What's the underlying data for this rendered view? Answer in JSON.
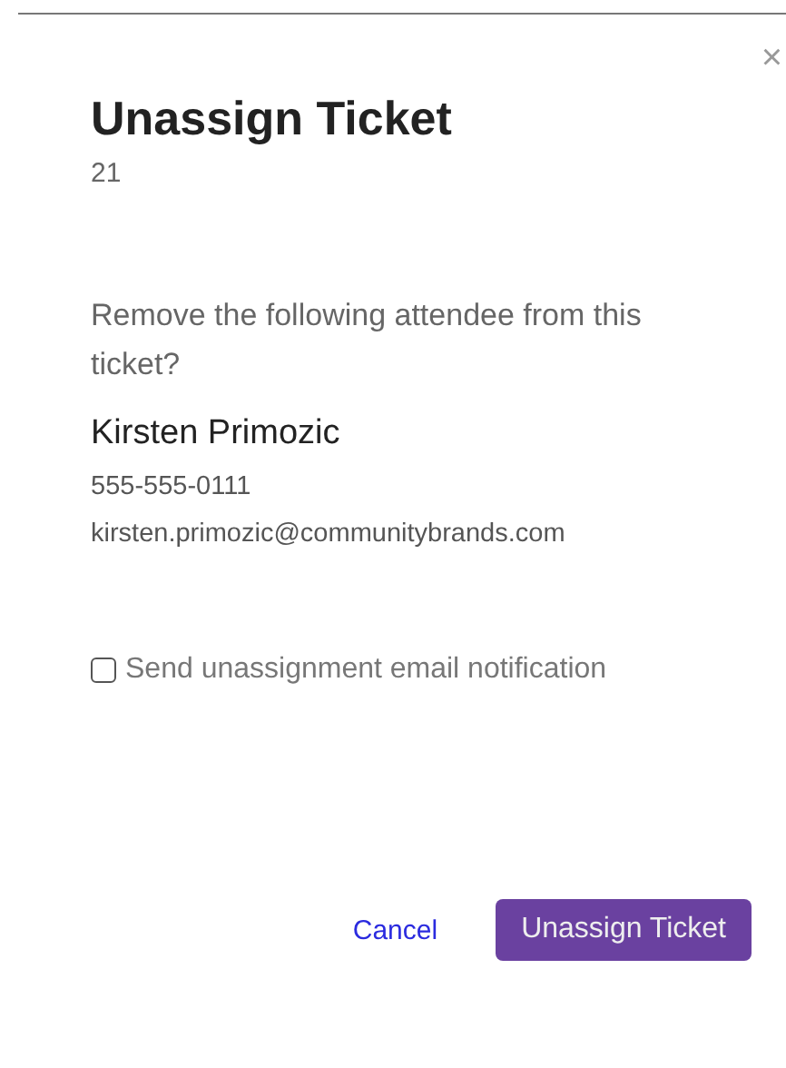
{
  "dialog": {
    "close": "×",
    "title": "Unassign Ticket",
    "ticket_number": "21",
    "message": "Remove the following attendee from this ticket?",
    "attendee": {
      "name": "Kirsten Primozic",
      "phone": "555-555-0111",
      "email": "kirsten.primozic@communitybrands.com"
    },
    "notify": {
      "label": "Send unassignment email notification",
      "checked": false
    },
    "buttons": [
      {
        "label": "Cancel",
        "kind": "link"
      },
      {
        "label": "Unassign Ticket",
        "kind": "primary"
      }
    ]
  }
}
